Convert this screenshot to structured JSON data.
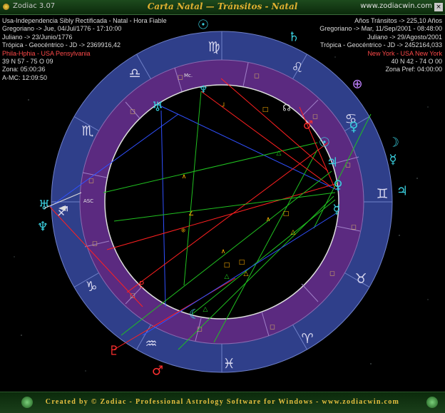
{
  "titlebar": {
    "app_name": "Zodiac 3.07",
    "title": "Carta Natal — Tránsitos - Natal",
    "site": "www.zodiacwin.com",
    "close": "×"
  },
  "left_info": {
    "lines": [
      "Usa-Independencia Sibly Rectificada - Natal - Hora Fiable",
      "Gregoriano -> Jue, 04/Jul/1776 - 17:10:00",
      "Juliano -> 23/Junio/1776",
      "Trópica - Geocéntrico - JD -> 2369916,42",
      "Phila-Hphia - USA Pensylvania",
      "39 N 57 - 75 O 09",
      "Zona: 05:00:36",
      "A-MC: 12:09:50"
    ],
    "highlight_line": 4
  },
  "right_info": {
    "lines": [
      "Años Tránsitos -> 225,10 Años",
      "Gregoriano -> Mar, 11/Sep/2001 - 08:48:00",
      "Juliano -> 29/Agosto/2001",
      "Trópica - Geocéntrico - JD -> 2452164,033",
      "New York - USA New York",
      "40 N 42 - 74 O 00",
      "Zona Pref: 04:00:00"
    ],
    "highlight_line": 4
  },
  "wheel": {
    "signs": [
      "♈",
      "♉",
      "♊",
      "♋",
      "♌",
      "♍",
      "♎",
      "♏",
      "♐",
      "♑",
      "♒",
      "♓"
    ],
    "labels": {
      "asc": "ASC",
      "mc": "Mc."
    },
    "colors": {
      "zodiac_ring": "#2f3f8a",
      "house_ring": "#5b2a80",
      "inner": "#000000",
      "accent": "#3ad0e0"
    }
  },
  "footer": {
    "text": "Created by © Zodiac - Professional Astrology Software for Windows - www.zodiacwin.com"
  }
}
